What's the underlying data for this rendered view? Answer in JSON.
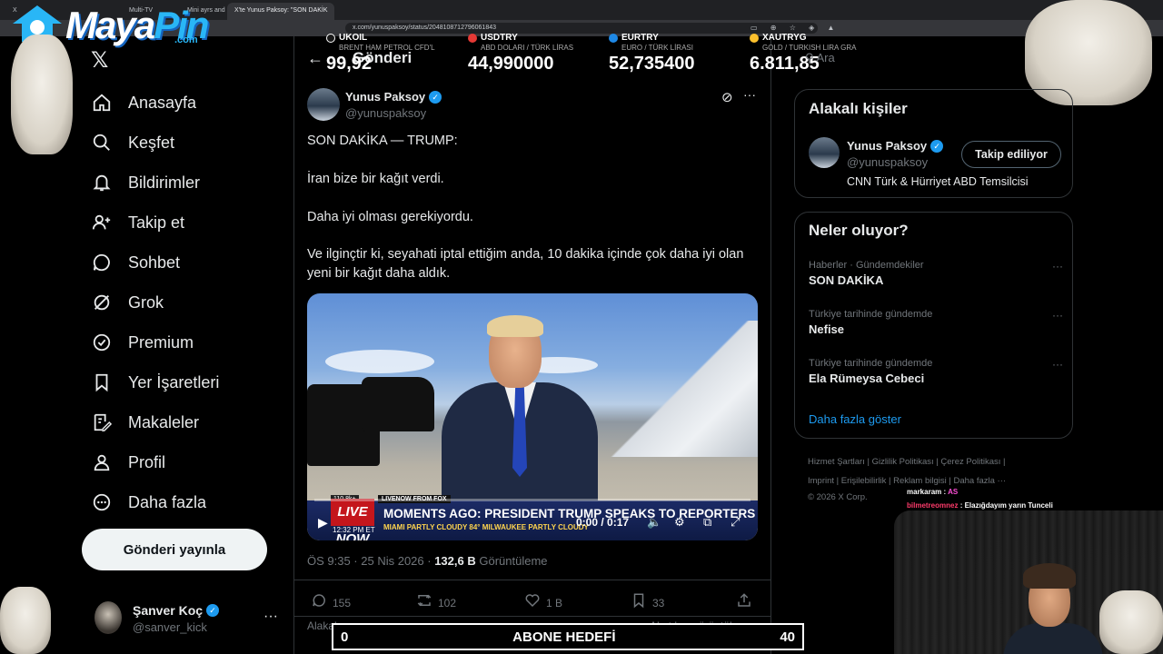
{
  "browser": {
    "tabs": [
      "X",
      "Multi-TV",
      "Mini ayrs and",
      "X'te Yunus Paksoy: \"SON DAKİK"
    ],
    "url": "x.com/yunuspaksoy/status/2048108712796061843"
  },
  "brand_overlay": {
    "logo_main": "Maya",
    "logo_accent": "Pin",
    "logo_suffix": ".com"
  },
  "ticker": [
    {
      "symbol": "UKOIL",
      "sub": "BRENT HAM PETROL CFD'L",
      "value": "99,92",
      "color": "#1a1a1a"
    },
    {
      "symbol": "USDTRY",
      "sub": "ABD DOLARI / TÜRK LİRAS",
      "value": "44,990000",
      "color": "#e53935"
    },
    {
      "symbol": "EURTRY",
      "sub": "EURO / TÜRK LİRASI",
      "value": "52,735400",
      "color": "#1e88e5"
    },
    {
      "symbol": "XAUTRYG",
      "sub": "GOLD / TURKISH LIRA GRA",
      "value": "6.811,85",
      "color": "#fbc02d"
    }
  ],
  "sidebar": {
    "items": [
      {
        "label": "Anasayfa",
        "icon": "home-icon"
      },
      {
        "label": "Keşfet",
        "icon": "search-icon"
      },
      {
        "label": "Bildirimler",
        "icon": "bell-icon"
      },
      {
        "label": "Takip et",
        "icon": "follow-icon"
      },
      {
        "label": "Sohbet",
        "icon": "chat-icon"
      },
      {
        "label": "Grok",
        "icon": "grok-icon"
      },
      {
        "label": "Premium",
        "icon": "premium-icon"
      },
      {
        "label": "Yer İşaretleri",
        "icon": "bookmark-icon"
      },
      {
        "label": "Makaleler",
        "icon": "article-icon"
      },
      {
        "label": "Profil",
        "icon": "profile-icon"
      },
      {
        "label": "Daha fazla",
        "icon": "more-icon"
      }
    ],
    "post_button": "Gönderi yayınla",
    "account": {
      "name": "Şanver Koç",
      "handle": "@sanver_kick"
    }
  },
  "post": {
    "header": "Gönderi",
    "author": {
      "name": "Yunus Paksoy",
      "handle": "@yunuspaksoy"
    },
    "paragraphs": [
      "SON DAKİKA — TRUMP:",
      "İran bize bir kağıt verdi.",
      "Daha iyi olması gerekiyordu.",
      "Ve ilginçtir ki, seyahati iptal ettiğim anda, 10 dakika içinde çok daha iyi olan yeni bir kağıt daha aldık."
    ],
    "video": {
      "views_badge": "110.8k+",
      "feed_label": "LIVENOW FROM FOX",
      "live": "LIVE NOW",
      "headline": "MOMENTS AGO: PRESIDENT TRUMP SPEAKS TO REPORTERS",
      "weather": "MIAMI   PARTLY CLOUDY 84°   MILWAUKEE   PARTLY CLOUDY",
      "clock": "12:32 PM ET",
      "time": "0:00 / 0:17",
      "progress": 0.0
    },
    "time": "ÖS 9:35 · 25 Nis 2026",
    "views_count": "132,6 B",
    "views_label": "Görüntüleme",
    "actions": {
      "replies": "155",
      "reposts": "102",
      "likes": "1 B",
      "bookmarks": "33"
    },
    "sort_label": "Alakalı",
    "quotes_label": "Alıntıları görüntüle"
  },
  "right": {
    "search_placeholder": "Ara",
    "related": {
      "title": "Alakalı kişiler",
      "name": "Yunus Paksoy",
      "handle": "@yunuspaksoy",
      "bio": "CNN Türk & Hürriyet ABD Temsilcisi",
      "follow_label": "Takip ediliyor"
    },
    "trends": {
      "title": "Neler oluyor?",
      "items": [
        {
          "context": "Haberler · Gündemdekiler",
          "name": "SON DAKİKA"
        },
        {
          "context": "Türkiye tarihinde gündemde",
          "name": "Nefise"
        },
        {
          "context": "Türkiye tarihinde gündemde",
          "name": "Ela Rümeysa Cebeci"
        }
      ],
      "show_more": "Daha fazla göster"
    },
    "footer": {
      "line1": "Hizmet Şartları  |   Gizlilik Politikası  |   Çerez Politikası  |",
      "line2": "Imprint  |   Erişilebilirlik  |   Reklam bilgisi  |   Daha fazla ···",
      "line3": "© 2026 X Corp."
    }
  },
  "stream_chat": [
    {
      "user": "markaram",
      "message": "AS",
      "user_color": "#ffffff",
      "msg_color": "#ff4fd8"
    },
    {
      "user": "bilmetreomnez",
      "message": "Elazığdayım yarın Tunceli",
      "user_color": "#ff3b6b",
      "msg_color": "#ffffff"
    }
  ],
  "sub_goal": {
    "current": "0",
    "label": "ABONE HEDEFİ",
    "target": "40"
  }
}
